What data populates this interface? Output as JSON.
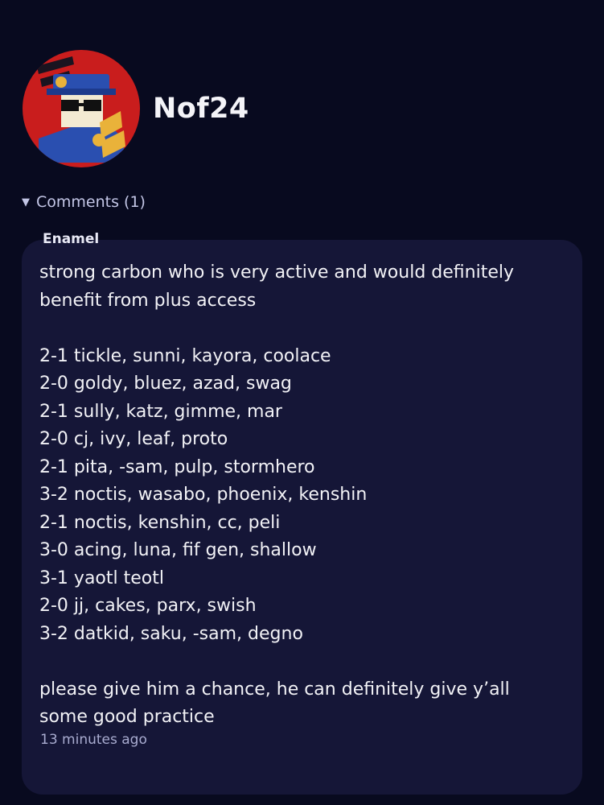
{
  "profile": {
    "username": "Nof24",
    "avatar_icon": "avatar-character-icon",
    "avatar_bg": "#c91d1d"
  },
  "comments": {
    "toggle_label": "Comments (1)",
    "caret_icon": "caret-down-icon",
    "items": [
      {
        "author": "Enamel",
        "intro": [
          "strong carbon who is very active and would definitely",
          "benefit from plus access"
        ],
        "results": [
          "2-1 tickle, sunni, kayora, coolace",
          "2-0 goldy, bluez, azad, swag",
          "2-1 sully, katz, gimme, mar",
          "2-0 cj, ivy, leaf, proto",
          "2-1 pita, -sam, pulp, stormhero",
          "3-2 noctis, wasabo, phoenix, kenshin",
          "2-1 noctis, kenshin, cc, peli",
          "3-0 acing, luna, fif gen, shallow",
          "3-1 yaotl teotl",
          "2-0 jj, cakes, parx, swish",
          "3-2 datkid, saku, -sam, degno"
        ],
        "outro": [
          "please give him a chance, he can definitely give y’all",
          "some good practice"
        ],
        "timestamp": "13 minutes ago"
      }
    ]
  },
  "colors": {
    "background": "#080a1f",
    "card": "#151637",
    "muted_text": "#a9acd0"
  }
}
